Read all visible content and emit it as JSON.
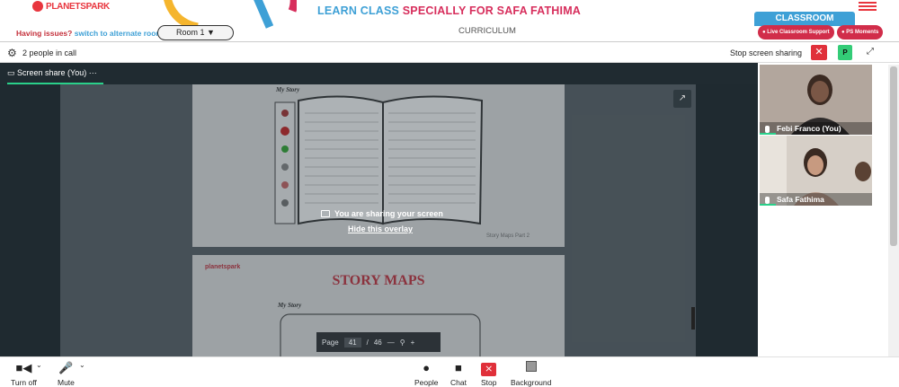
{
  "header": {
    "logo_text": "PLANETSPARK",
    "title_part1": "LEARN CLASS ",
    "title_part2": "SPECIALLY FOR SAFA FATHIMA",
    "classroom_label": "CLASSROOM",
    "issues_text": "Having issues?",
    "switch_link": "switch to alternate room",
    "room_label": "Room 1",
    "curriculum_label": "CURRICULUM",
    "live_support_label": "Live Classroom Support",
    "ps_moments_label": "PS Moments"
  },
  "call_bar": {
    "people_count": "2 people in call",
    "stop_sharing_label": "Stop screen sharing",
    "participant_initial": "P"
  },
  "stage": {
    "tab_label": "Screen share (You)",
    "tab_more": "···",
    "sharing_message": "You are sharing your screen",
    "hide_overlay": "Hide this overlay"
  },
  "document": {
    "page1_heading": "My Story",
    "page1_caption": "Story Maps Part 2",
    "page2_logo": "planetspark",
    "page2_title": "STORY MAPS",
    "page2_heading": "My Story",
    "pager_label": "Page",
    "page_current": "41",
    "page_total": "46"
  },
  "participants": [
    {
      "name": "Febi Franco (You)"
    },
    {
      "name": "Safa Fathima"
    }
  ],
  "controls": [
    {
      "label": "Turn off",
      "icon": "camera-icon"
    },
    {
      "label": "Mute",
      "icon": "microphone-icon"
    },
    {
      "label": "People",
      "icon": "person-icon"
    },
    {
      "label": "Chat",
      "icon": "chat-icon"
    },
    {
      "label": "Stop",
      "icon": "stop-share-icon"
    },
    {
      "label": "Background",
      "icon": "background-icon"
    }
  ],
  "colors": {
    "brand_red": "#e8353e",
    "brand_blue": "#3ea0d6",
    "accent_green": "#2ad08a"
  }
}
